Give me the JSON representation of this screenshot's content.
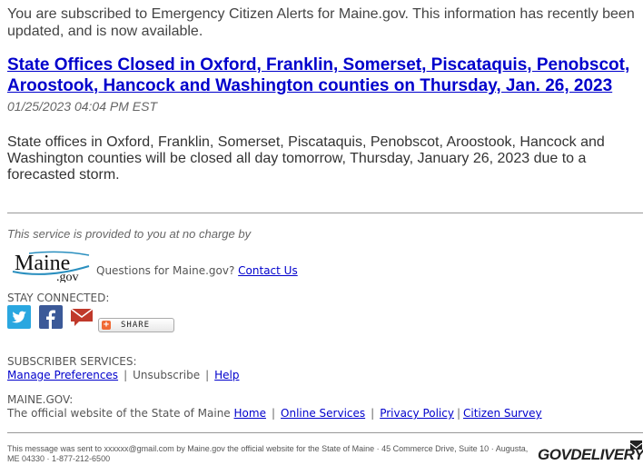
{
  "intro": "You are subscribed to Emergency Citizen Alerts for Maine.gov. This information has recently been updated, and is now available.",
  "headline": "State Offices Closed in Oxford, Franklin, Somerset, Piscataquis, Penobscot, Aroostook, Hancock and Washington counties on Thursday, Jan. 26, 2023",
  "timestamp": "01/25/2023 04:04 PM EST",
  "body": "State offices in Oxford, Franklin, Somerset, Piscataquis, Penobscot, Aroostook, Hancock and Washington counties will be closed all day tomorrow, Thursday, January 26, 2023 due to a forecasted storm.",
  "provided_by": "This service is provided to you at no charge by",
  "logo": {
    "main": "Maine",
    "sub": ".gov"
  },
  "questions": {
    "text": "Questions for Maine.gov?",
    "link": "Contact Us"
  },
  "stay_connected": {
    "title": "STAY CONNECTED:",
    "icons": [
      "twitter-icon",
      "facebook-icon",
      "email-icon"
    ],
    "share_label": "SHARE",
    "twitter_color": "#2aa7e0",
    "facebook_color": "#3b5998"
  },
  "subscriber_services": {
    "title": "SUBSCRIBER SERVICES:",
    "manage": "Manage Preferences",
    "unsubscribe": "Unsubscribe",
    "help": "Help",
    "sep": "|"
  },
  "maine_gov": {
    "title": "MAINE.GOV:",
    "text": "The official website of the State of Maine",
    "home": "Home",
    "online_services": "Online Services",
    "privacy": "Privacy Policy",
    "survey": "Citizen Survey"
  },
  "footer": "This message was sent to xxxxxx@gmail.com by Maine.gov the official website for the State of Maine · 45 Commerce Drive, Suite 10 · Augusta, ME 04330 · 1-877-212-6500",
  "govdelivery": "GOVDELIVERY"
}
